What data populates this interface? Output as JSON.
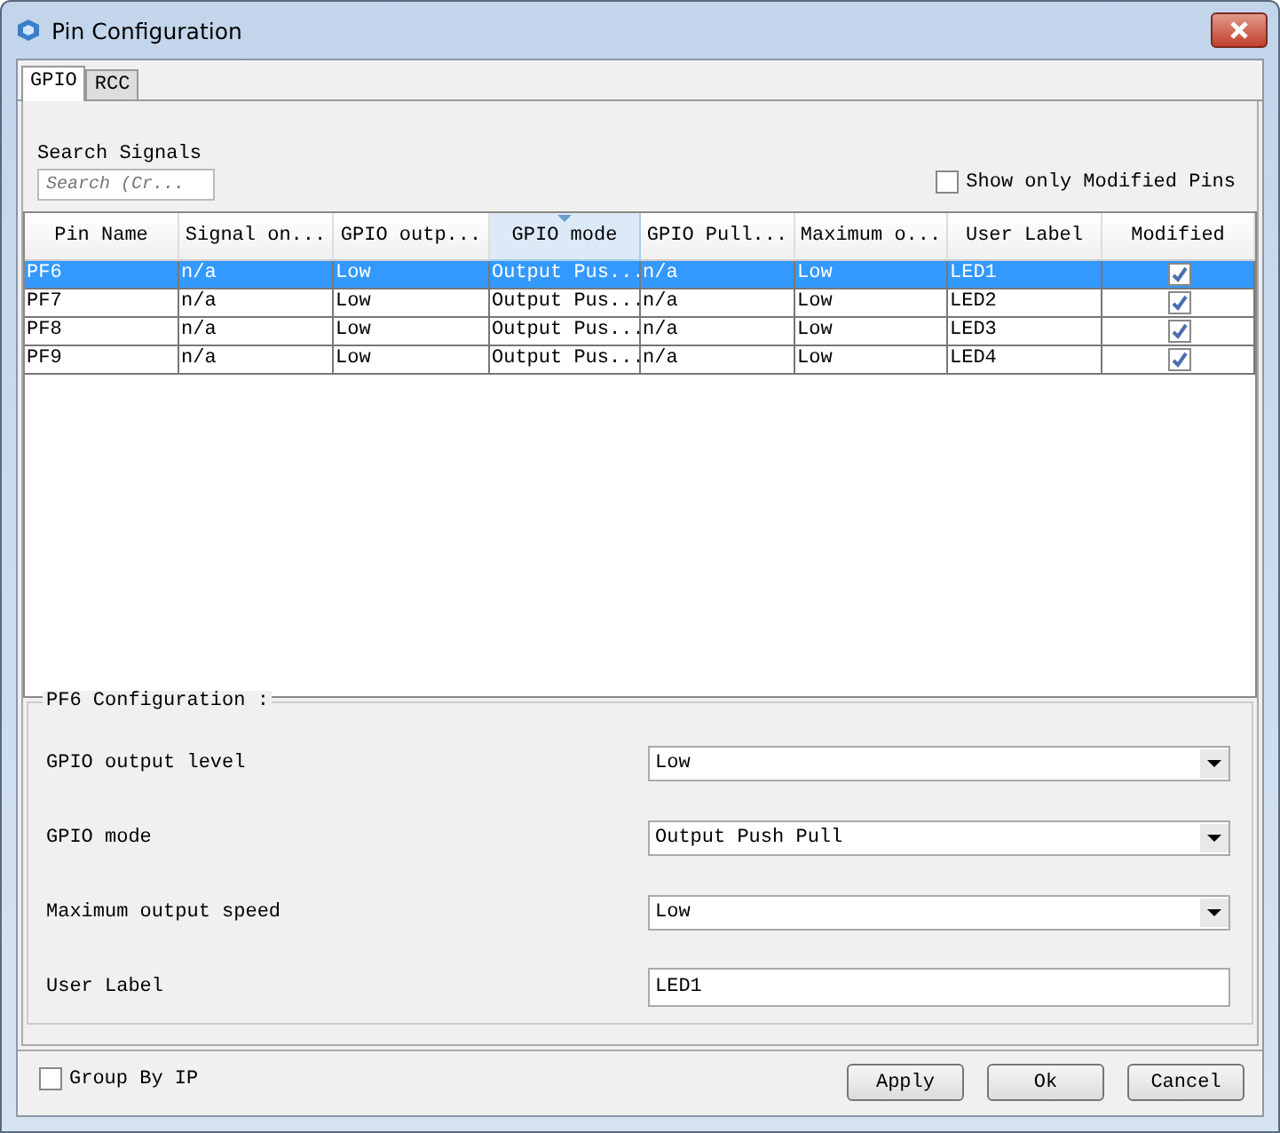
{
  "window": {
    "title": "Pin Configuration"
  },
  "tabs": [
    {
      "label": "GPIO",
      "selected": true
    },
    {
      "label": "RCC",
      "selected": false
    }
  ],
  "search": {
    "label": "Search Signals",
    "placeholder": "Search (Cr..."
  },
  "show_only_modified": {
    "label": "Show only Modified Pins",
    "checked": false
  },
  "table": {
    "columns": [
      {
        "label": "Pin Name",
        "sorted": false
      },
      {
        "label": "Signal on...",
        "sorted": false
      },
      {
        "label": "GPIO outp...",
        "sorted": false
      },
      {
        "label": "GPIO mode",
        "sorted": true
      },
      {
        "label": "GPIO Pull...",
        "sorted": false
      },
      {
        "label": "Maximum o...",
        "sorted": false
      },
      {
        "label": "User Label",
        "sorted": false
      },
      {
        "label": "Modified",
        "sorted": false
      }
    ],
    "rows": [
      {
        "cells": [
          "PF6",
          "n/a",
          "Low",
          "Output Pus...",
          "n/a",
          "Low",
          "LED1"
        ],
        "modified": true,
        "selected": true
      },
      {
        "cells": [
          "PF7",
          "n/a",
          "Low",
          "Output Pus...",
          "n/a",
          "Low",
          "LED2"
        ],
        "modified": true,
        "selected": false
      },
      {
        "cells": [
          "PF8",
          "n/a",
          "Low",
          "Output Pus...",
          "n/a",
          "Low",
          "LED3"
        ],
        "modified": true,
        "selected": false
      },
      {
        "cells": [
          "PF9",
          "n/a",
          "Low",
          "Output Pus...",
          "n/a",
          "Low",
          "LED4"
        ],
        "modified": true,
        "selected": false
      }
    ]
  },
  "config": {
    "title": "PF6 Configuration :",
    "fields": [
      {
        "label": "GPIO output level",
        "kind": "select",
        "value": "Low"
      },
      {
        "label": "GPIO mode",
        "kind": "select",
        "value": "Output Push Pull"
      },
      {
        "label": "Maximum output speed",
        "kind": "select",
        "value": "Low"
      },
      {
        "label": "User Label",
        "kind": "text",
        "value": "LED1"
      }
    ]
  },
  "group_by_ip": {
    "label": "Group By IP",
    "checked": false
  },
  "buttons": [
    "Apply",
    "Ok",
    "Cancel"
  ]
}
